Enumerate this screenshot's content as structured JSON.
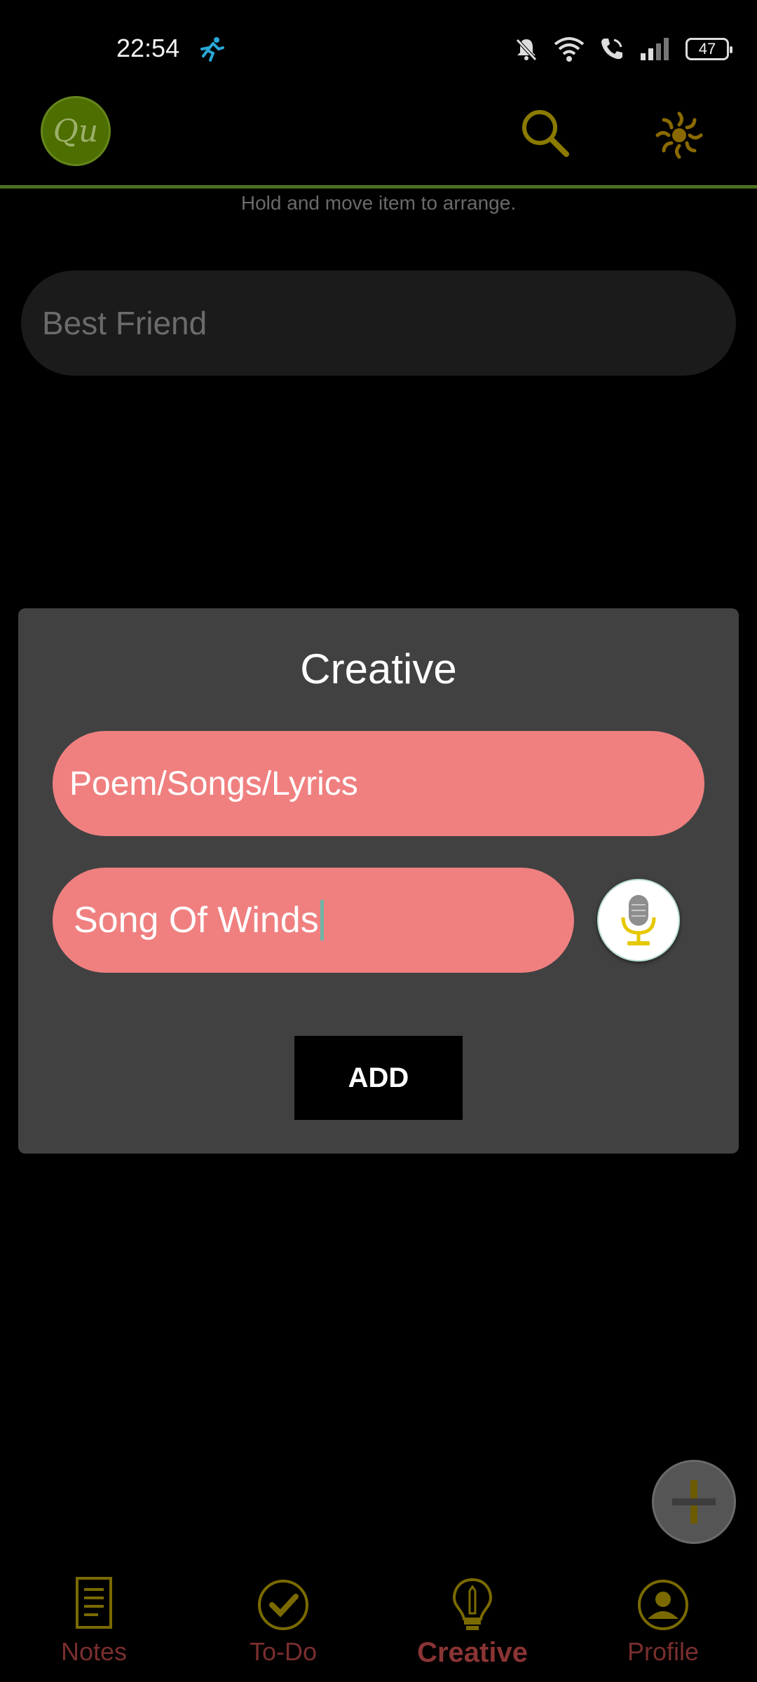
{
  "status_bar": {
    "time": "22:54",
    "battery": "47"
  },
  "app_bar": {
    "logo_text": "Qu"
  },
  "hint_text": "Hold and move item to arrange.",
  "list": {
    "items": [
      {
        "title": "Best Friend"
      }
    ]
  },
  "dialog": {
    "title": "Creative",
    "category_value": "Poem/Songs/Lyrics",
    "title_value": "Song Of Winds",
    "add_label": "ADD"
  },
  "bottom_nav": {
    "items": [
      {
        "label": "Notes"
      },
      {
        "label": "To-Do"
      },
      {
        "label": "Creative"
      },
      {
        "label": "Profile"
      }
    ],
    "active": "Creative"
  },
  "colors": {
    "accent_olive": "#8a7a00",
    "field_pink": "#f08080",
    "nav_red": "#7a2e2e",
    "divider_green": "#4b6f1f"
  }
}
